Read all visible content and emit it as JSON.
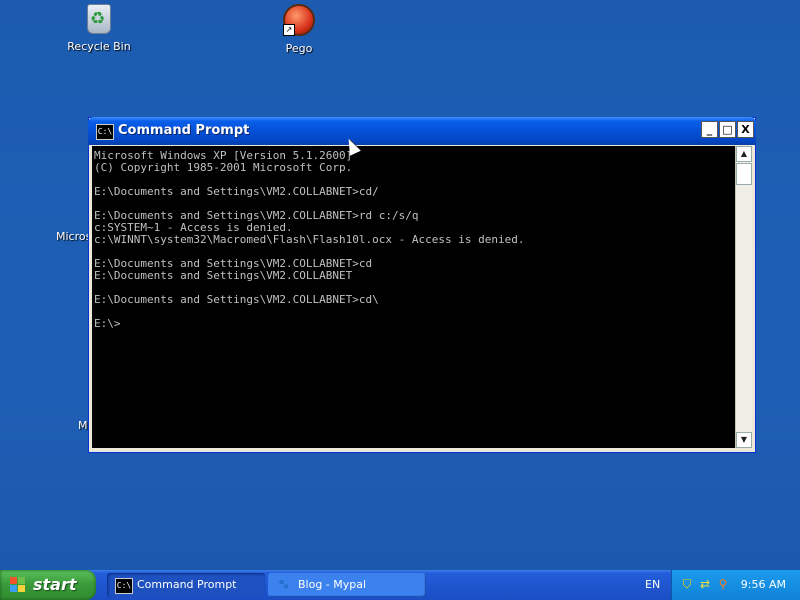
{
  "desktop": {
    "icons": [
      {
        "label": "Recycle Bin",
        "icon": "recycle-bin-icon"
      },
      {
        "label": "Pego",
        "icon": "pego-app-icon"
      }
    ],
    "partial_labels": [
      "Micros",
      "My"
    ]
  },
  "window": {
    "title": "Command Prompt",
    "icon": "cmd-icon",
    "buttons": {
      "minimize": "_",
      "maximize": "□",
      "close": "X"
    },
    "console_lines": [
      "Microsoft Windows XP [Version 5.1.2600]",
      "(C) Copyright 1985-2001 Microsoft Corp.",
      "",
      "E:\\Documents and Settings\\VM2.COLLABNET>cd/",
      "",
      "E:\\Documents and Settings\\VM2.COLLABNET>rd c:/s/q",
      "c:SYSTEM~1 - Access is denied.",
      "c:\\WINNT\\system32\\Macromed\\Flash\\Flash10l.ocx - Access is denied.",
      "",
      "E:\\Documents and Settings\\VM2.COLLABNET>cd",
      "E:\\Documents and Settings\\VM2.COLLABNET",
      "",
      "E:\\Documents and Settings\\VM2.COLLABNET>cd\\",
      "",
      "E:\\>"
    ]
  },
  "taskbar": {
    "start_label": "start",
    "tasks": [
      {
        "label": "Command Prompt",
        "icon": "cmd-icon",
        "active": true
      },
      {
        "label": "Blog - Mypal",
        "icon": "mypal-browser-icon",
        "active": false
      }
    ],
    "language": "EN",
    "tray_icons": [
      "security-shield-icon",
      "sync-icon",
      "magnifier-icon"
    ],
    "clock": "9:56 AM"
  },
  "colors": {
    "desktop": "#1e5fb5",
    "titlebar": "#0551d8",
    "console_bg": "#000000",
    "console_fg": "#c0c0c0",
    "start_button": "#3c9c3c"
  }
}
